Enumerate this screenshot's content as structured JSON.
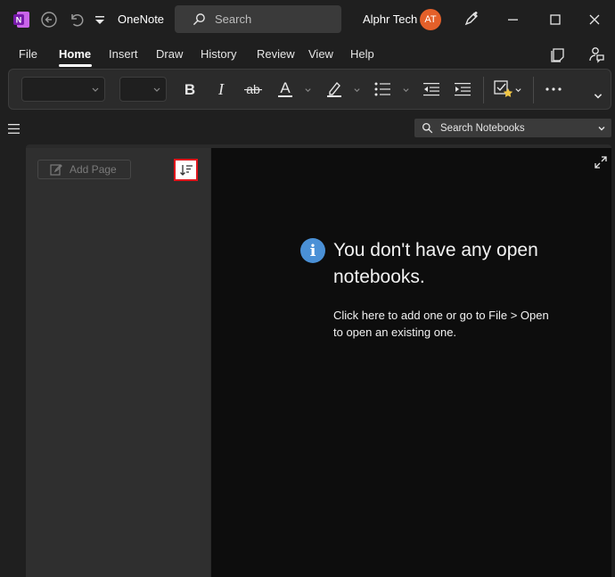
{
  "titlebar": {
    "app_title": "OneNote",
    "search_placeholder": "Search",
    "user_name": "Alphr Tech",
    "user_initials": "AT"
  },
  "menu": {
    "tabs": [
      "File",
      "Home",
      "Insert",
      "Draw",
      "History",
      "Review",
      "View",
      "Help"
    ],
    "active_tab": "Home"
  },
  "ribbon": {
    "tools": [
      "bold-icon",
      "italic-icon",
      "strikethrough-icon",
      "font-color-icon",
      "highlight-icon",
      "bullets-icon",
      "decrease-indent-icon",
      "increase-indent-icon",
      "todo-tag-icon",
      "more-icon"
    ]
  },
  "notebooks": {
    "search_placeholder": "Search Notebooks"
  },
  "page_pane": {
    "add_page_label": "Add Page"
  },
  "empty_state": {
    "title": "You don't have any open notebooks.",
    "description": "Click here to add one or go to File > Open to open an existing one."
  },
  "colors": {
    "accent_onenote": "#7719aa",
    "avatar": "#e4602a",
    "info": "#4a90d6",
    "highlight_box": "#e0151c"
  }
}
